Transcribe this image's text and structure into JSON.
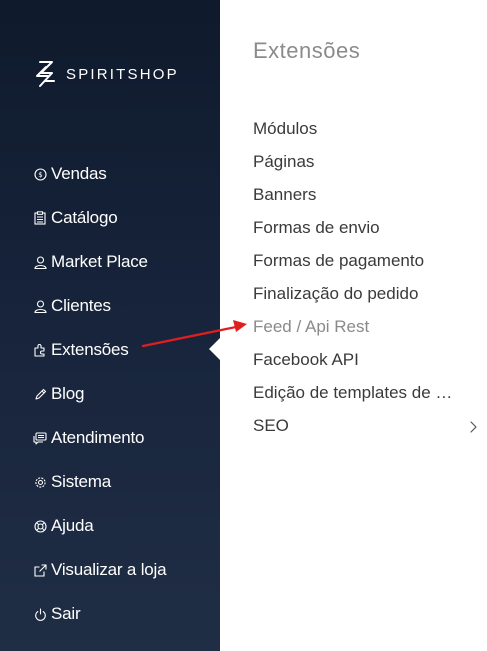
{
  "brand": {
    "name": "SPIRITSHOP",
    "logo_icon": "spiritshop-logo-icon"
  },
  "sidebar": {
    "items": [
      {
        "key": "vendas",
        "label": "Vendas",
        "icon": "dollar-circle-icon"
      },
      {
        "key": "catalogo",
        "label": "Catálogo",
        "icon": "clipboard-icon"
      },
      {
        "key": "marketplace",
        "label": "Market Place",
        "icon": "user-icon"
      },
      {
        "key": "clientes",
        "label": "Clientes",
        "icon": "user-icon"
      },
      {
        "key": "extensoes",
        "label": "Extensões",
        "icon": "puzzle-icon",
        "active": true
      },
      {
        "key": "blog",
        "label": "Blog",
        "icon": "pencil-icon"
      },
      {
        "key": "atendimento",
        "label": "Atendimento",
        "icon": "chat-icon"
      },
      {
        "key": "sistema",
        "label": "Sistema",
        "icon": "gear-icon"
      },
      {
        "key": "ajuda",
        "label": "Ajuda",
        "icon": "lifebuoy-icon"
      },
      {
        "key": "visualizar",
        "label": "Visualizar a loja",
        "icon": "external-link-icon"
      },
      {
        "key": "sair",
        "label": "Sair",
        "icon": "power-icon"
      }
    ]
  },
  "submenu": {
    "title": "Extensões",
    "items": [
      {
        "label": "Módulos"
      },
      {
        "label": "Páginas"
      },
      {
        "label": "Banners"
      },
      {
        "label": "Formas de envio"
      },
      {
        "label": "Formas de pagamento"
      },
      {
        "label": "Finalização do pedido"
      },
      {
        "label": "Feed / Api Rest",
        "highlighted": true
      },
      {
        "label": "Facebook API"
      },
      {
        "label": "Edição de templates de e-mail"
      },
      {
        "label": "SEO",
        "has_children": true
      }
    ]
  },
  "colors": {
    "sidebar_bg": "#14213a",
    "annotation_arrow": "#e01e1e",
    "title": "#8b8b8b",
    "item_text": "#3a3a3a",
    "item_muted": "#8a8a8a"
  }
}
